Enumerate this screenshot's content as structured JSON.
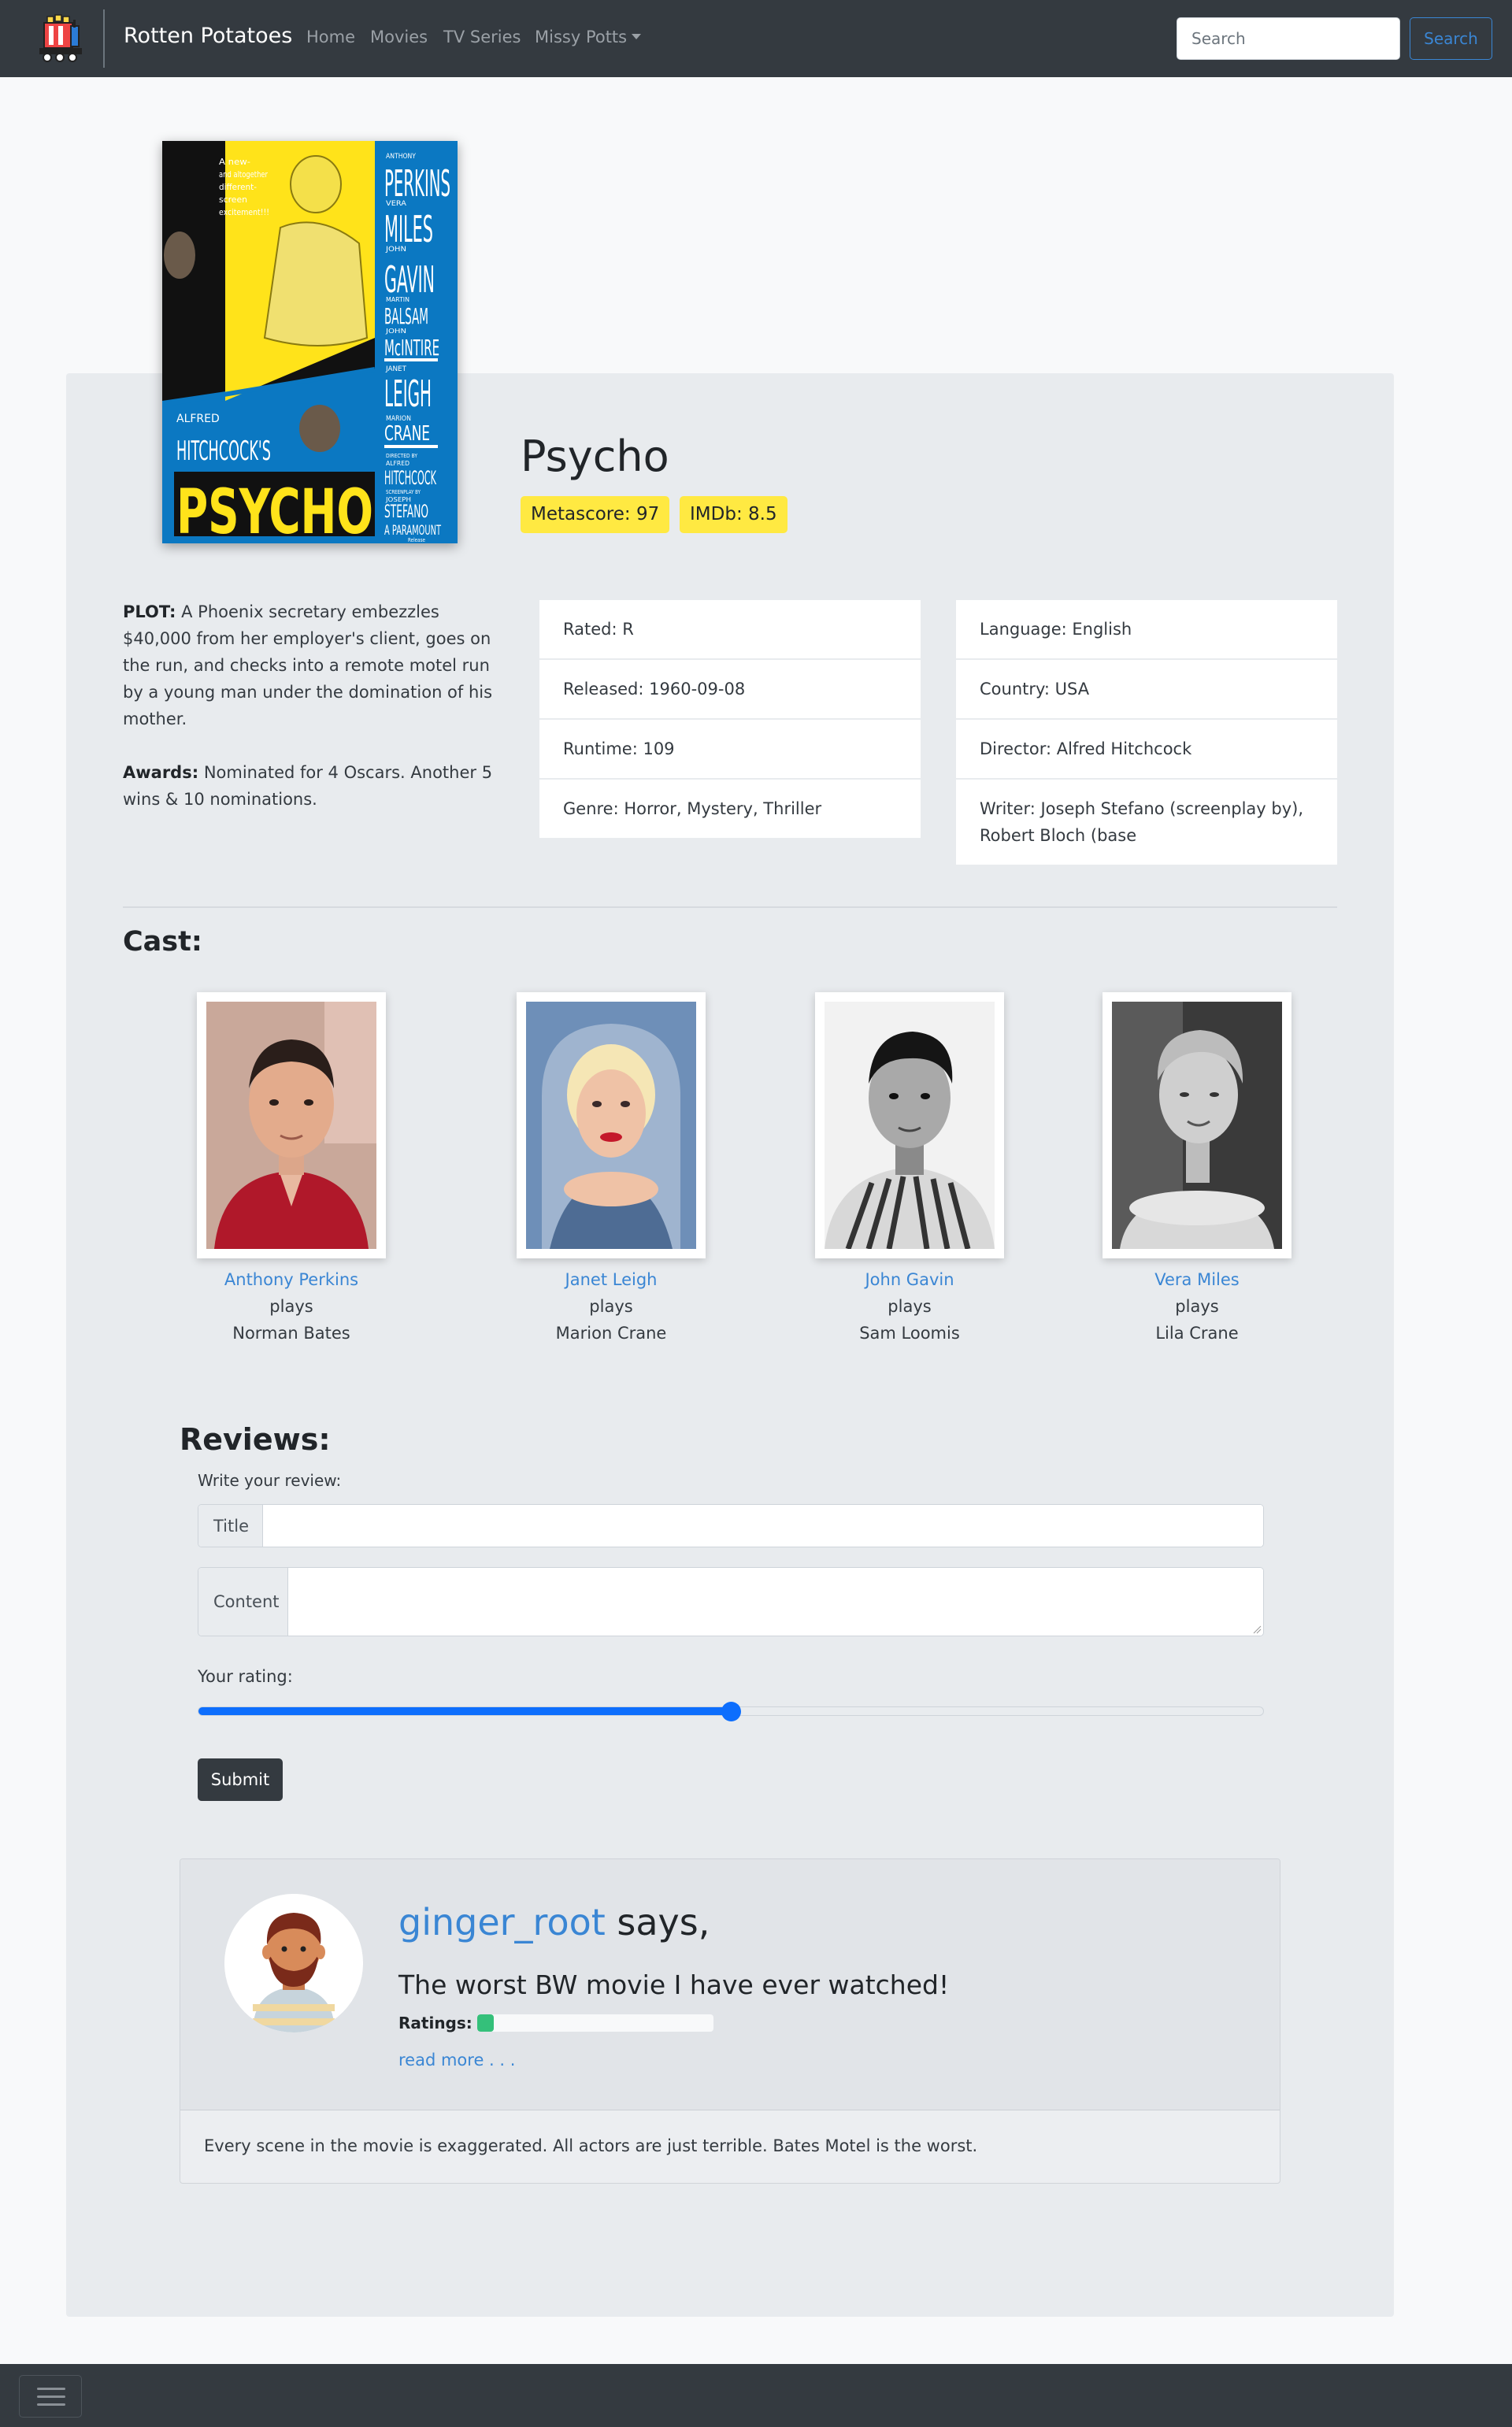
{
  "navbar": {
    "brand": "Rotten Potatoes",
    "links": [
      "Home",
      "Movies",
      "TV Series"
    ],
    "user_menu": "Missy Potts",
    "search_placeholder": "Search",
    "search_button": "Search"
  },
  "movie": {
    "title": "Psycho",
    "metascore": "Metascore: 97",
    "imdb": "IMDb: 8.5",
    "plot_label": "PLOT:",
    "plot": "A Phoenix secretary embezzles $40,000 from her employer's client, goes on the run, and checks into a remote motel run by a young man under the domination of his mother.",
    "awards_label": "Awards:",
    "awards": "Nominated for 4 Oscars. Another 5 wins & 10 nominations.",
    "details_left": [
      "Rated: R",
      "Released: 1960-09-08",
      "Runtime: 109",
      "Genre: Horror, Mystery, Thriller"
    ],
    "details_right": [
      "Language: English",
      "Country: USA",
      "Director: Alfred Hitchcock",
      "Writer: Joseph Stefano (screenplay by), Robert Bloch (base"
    ],
    "poster_text": {
      "tagline": "A new- and altogether different- screen excitement!!!",
      "cast_names": [
        "ANTHONY",
        "PERKINS",
        "VERA",
        "MILES",
        "JOHN",
        "GAVIN",
        "MARTIN",
        "BALSAM",
        "JOHN",
        "McINTIRE",
        "JANET",
        "LEIGH",
        "MARION",
        "CRANE"
      ],
      "credit_lines": [
        "DIRECTED BY",
        "ALFRED",
        "HITCHCOCK",
        "SCREENPLAY BY",
        "JOSEPH",
        "STEFANO",
        "A PARAMOUNT",
        "Release"
      ],
      "director": "ALFRED",
      "studio": "HITCHCOCK'S",
      "film": "PSYCHO"
    }
  },
  "cast": {
    "title": "Cast:",
    "plays": "plays",
    "members": [
      {
        "actor": "Anthony Perkins",
        "role": "Norman Bates"
      },
      {
        "actor": "Janet Leigh",
        "role": "Marion Crane"
      },
      {
        "actor": "John Gavin",
        "role": "Sam Loomis"
      },
      {
        "actor": "Vera Miles",
        "role": "Lila Crane"
      }
    ]
  },
  "reviews": {
    "title": "Reviews:",
    "write_label": "Write your review:",
    "title_field_label": "Title",
    "title_field_value": "",
    "content_field_label": "Content",
    "content_field_value": "",
    "rating_label": "Your rating:",
    "rating_fraction": 0.5,
    "submit": "Submit",
    "items": [
      {
        "user": "ginger_root",
        "says": " says,",
        "title": "The worst BW movie I have ever watched!",
        "ratings_label": "Ratings:",
        "rating_fraction": 0.07,
        "read_more": "read more . . .",
        "content": "Every scene in the movie is exaggerated. All actors are just terrible. Bates Motel is the worst."
      }
    ]
  },
  "colors": {
    "navbar": "#343a40",
    "accent": "#3a86d4",
    "badge": "#ffe942",
    "slider": "#0d6efd",
    "rating_bar": "#34c07a"
  },
  "icons": {
    "logo": "popcorn-cart-logo",
    "menu": "hamburger-menu-icon"
  }
}
